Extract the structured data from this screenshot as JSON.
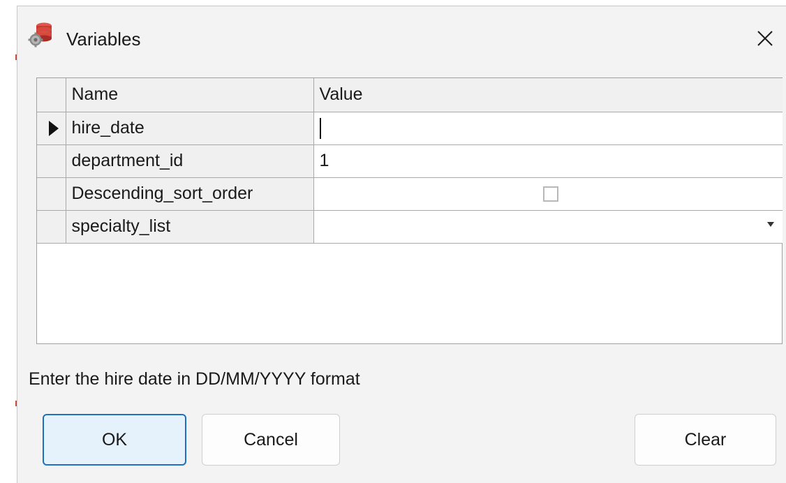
{
  "window": {
    "title": "Variables",
    "app_icon": "database-gear-icon",
    "close_icon": "close-icon"
  },
  "grid": {
    "columns": [
      "Name",
      "Value"
    ],
    "rows": [
      {
        "name": "hire_date",
        "value": "",
        "kind": "text",
        "current": true
      },
      {
        "name": "department_id",
        "value": "1",
        "kind": "text",
        "current": false
      },
      {
        "name": "Descending_sort_order",
        "value": "",
        "kind": "checkbox",
        "checked": false,
        "current": false
      },
      {
        "name": "specialty_list",
        "value": "",
        "kind": "dropdown",
        "current": false
      }
    ]
  },
  "hint": "Enter the hire date in DD/MM/YYYY format",
  "buttons": {
    "ok": "OK",
    "cancel": "Cancel",
    "clear": "Clear"
  },
  "colors": {
    "accent": "#1f6fbf",
    "primary_button_bg": "#e5f1fb",
    "dialog_bg": "#f3f3f3"
  }
}
